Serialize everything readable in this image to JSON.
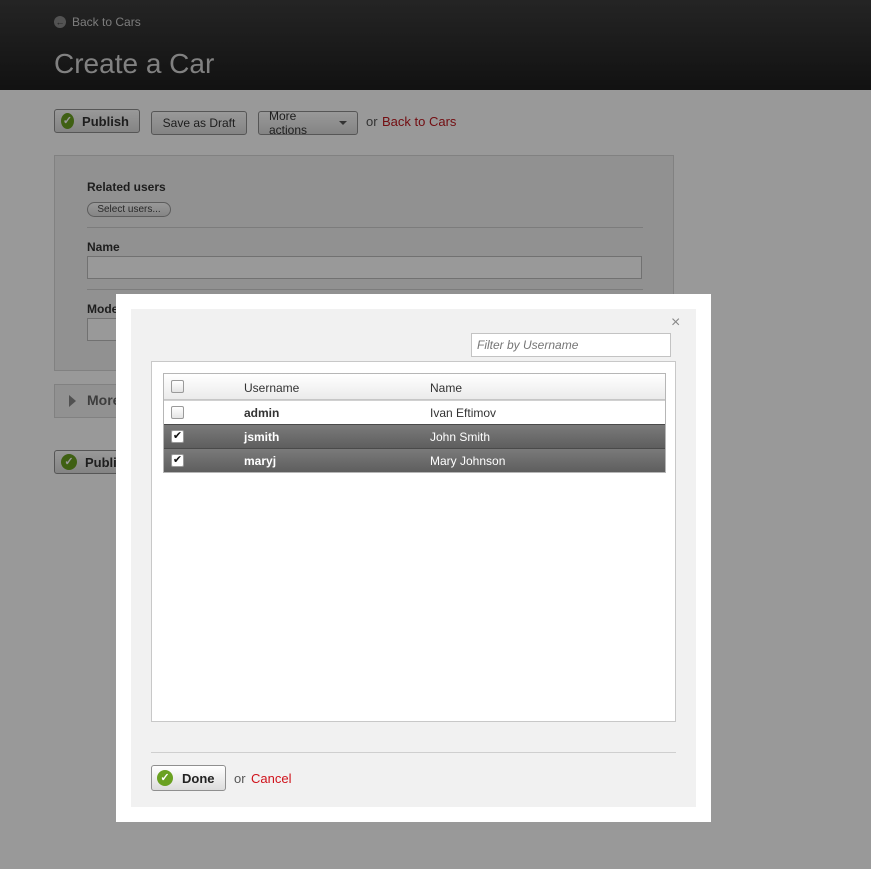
{
  "header": {
    "back_link": "Back to Cars",
    "title": "Create a Car"
  },
  "toolbar": {
    "publish_label": "Publish",
    "save_draft_label": "Save as Draft",
    "more_actions_label": "More actions",
    "or_text": "or",
    "back_link": "Back to Cars"
  },
  "form": {
    "related_users_label": "Related users",
    "select_users_label": "Select users...",
    "name_label": "Name",
    "name_value": "",
    "model_label": "Mode",
    "model_value": ""
  },
  "more_section": {
    "label": "More"
  },
  "bottom_toolbar": {
    "publish_label": "Publis"
  },
  "modal": {
    "close_label": "×",
    "filter_placeholder": "Filter by Username",
    "columns": {
      "username": "Username",
      "name": "Name"
    },
    "rows": [
      {
        "username": "admin",
        "name": "Ivan Eftimov",
        "checked": false
      },
      {
        "username": "jsmith",
        "name": "John Smith",
        "checked": true
      },
      {
        "username": "maryj",
        "name": "Mary Johnson",
        "checked": true
      }
    ],
    "done_label": "Done",
    "or_text": "or",
    "cancel_label": "Cancel"
  },
  "colors": {
    "accent_green": "#6aa121",
    "link_red": "#d0121b",
    "selected_row": "#6b6b6b"
  },
  "icons": {
    "check": "✓",
    "checkbox_checked": "✔",
    "back": "←"
  }
}
